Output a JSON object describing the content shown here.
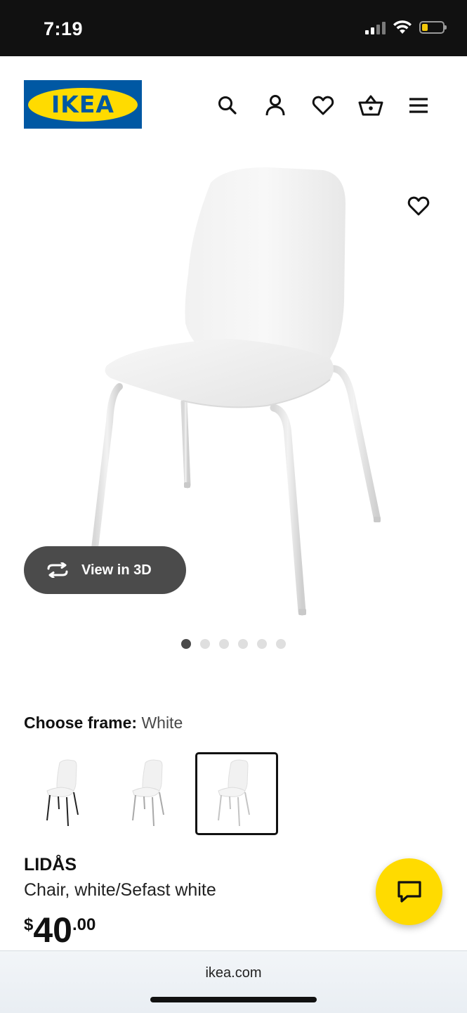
{
  "status_bar": {
    "time": "7:19",
    "battery_color": "#f2c70a"
  },
  "header": {
    "logo_text": "IKEA",
    "logo_colors": {
      "blue": "#0058a3",
      "yellow": "#ffdb00"
    },
    "icons": [
      "search-icon",
      "account-icon",
      "heart-icon",
      "basket-icon",
      "menu-icon"
    ]
  },
  "hero": {
    "view_3d_label": "View in 3D",
    "carousel": {
      "count": 6,
      "active_index": 0
    }
  },
  "options": {
    "choose_label": "Choose frame:",
    "choose_value": "White",
    "variants": [
      {
        "frame": "black",
        "selected": false
      },
      {
        "frame": "silver",
        "selected": false
      },
      {
        "frame": "white",
        "selected": true
      }
    ]
  },
  "product": {
    "name": "LIDÅS",
    "description": "Chair, white/Sefast white",
    "price_currency": "$",
    "price_whole": "40",
    "price_cents": ".00"
  },
  "chat": {
    "color": "#ffdb00"
  },
  "browser": {
    "url": "ikea.com"
  }
}
